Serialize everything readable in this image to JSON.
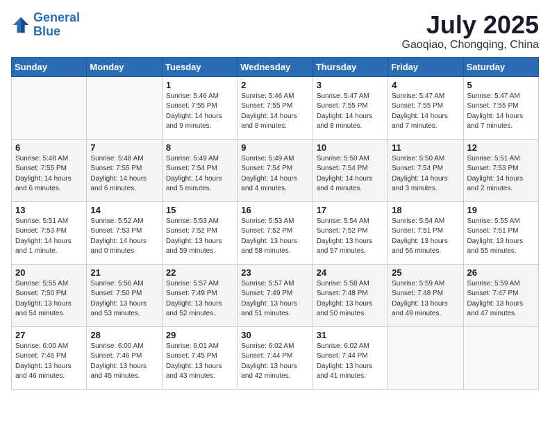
{
  "logo": {
    "line1": "General",
    "line2": "Blue"
  },
  "title": "July 2025",
  "location": "Gaoqiao, Chongqing, China",
  "days_of_week": [
    "Sunday",
    "Monday",
    "Tuesday",
    "Wednesday",
    "Thursday",
    "Friday",
    "Saturday"
  ],
  "weeks": [
    [
      {
        "day": "",
        "info": ""
      },
      {
        "day": "",
        "info": ""
      },
      {
        "day": "1",
        "info": "Sunrise: 5:46 AM\nSunset: 7:55 PM\nDaylight: 14 hours\nand 9 minutes."
      },
      {
        "day": "2",
        "info": "Sunrise: 5:46 AM\nSunset: 7:55 PM\nDaylight: 14 hours\nand 8 minutes."
      },
      {
        "day": "3",
        "info": "Sunrise: 5:47 AM\nSunset: 7:55 PM\nDaylight: 14 hours\nand 8 minutes."
      },
      {
        "day": "4",
        "info": "Sunrise: 5:47 AM\nSunset: 7:55 PM\nDaylight: 14 hours\nand 7 minutes."
      },
      {
        "day": "5",
        "info": "Sunrise: 5:47 AM\nSunset: 7:55 PM\nDaylight: 14 hours\nand 7 minutes."
      }
    ],
    [
      {
        "day": "6",
        "info": "Sunrise: 5:48 AM\nSunset: 7:55 PM\nDaylight: 14 hours\nand 6 minutes."
      },
      {
        "day": "7",
        "info": "Sunrise: 5:48 AM\nSunset: 7:55 PM\nDaylight: 14 hours\nand 6 minutes."
      },
      {
        "day": "8",
        "info": "Sunrise: 5:49 AM\nSunset: 7:54 PM\nDaylight: 14 hours\nand 5 minutes."
      },
      {
        "day": "9",
        "info": "Sunrise: 5:49 AM\nSunset: 7:54 PM\nDaylight: 14 hours\nand 4 minutes."
      },
      {
        "day": "10",
        "info": "Sunrise: 5:50 AM\nSunset: 7:54 PM\nDaylight: 14 hours\nand 4 minutes."
      },
      {
        "day": "11",
        "info": "Sunrise: 5:50 AM\nSunset: 7:54 PM\nDaylight: 14 hours\nand 3 minutes."
      },
      {
        "day": "12",
        "info": "Sunrise: 5:51 AM\nSunset: 7:53 PM\nDaylight: 14 hours\nand 2 minutes."
      }
    ],
    [
      {
        "day": "13",
        "info": "Sunrise: 5:51 AM\nSunset: 7:53 PM\nDaylight: 14 hours\nand 1 minute."
      },
      {
        "day": "14",
        "info": "Sunrise: 5:52 AM\nSunset: 7:53 PM\nDaylight: 14 hours\nand 0 minutes."
      },
      {
        "day": "15",
        "info": "Sunrise: 5:53 AM\nSunset: 7:52 PM\nDaylight: 13 hours\nand 59 minutes."
      },
      {
        "day": "16",
        "info": "Sunrise: 5:53 AM\nSunset: 7:52 PM\nDaylight: 13 hours\nand 58 minutes."
      },
      {
        "day": "17",
        "info": "Sunrise: 5:54 AM\nSunset: 7:52 PM\nDaylight: 13 hours\nand 57 minutes."
      },
      {
        "day": "18",
        "info": "Sunrise: 5:54 AM\nSunset: 7:51 PM\nDaylight: 13 hours\nand 56 minutes."
      },
      {
        "day": "19",
        "info": "Sunrise: 5:55 AM\nSunset: 7:51 PM\nDaylight: 13 hours\nand 55 minutes."
      }
    ],
    [
      {
        "day": "20",
        "info": "Sunrise: 5:55 AM\nSunset: 7:50 PM\nDaylight: 13 hours\nand 54 minutes."
      },
      {
        "day": "21",
        "info": "Sunrise: 5:56 AM\nSunset: 7:50 PM\nDaylight: 13 hours\nand 53 minutes."
      },
      {
        "day": "22",
        "info": "Sunrise: 5:57 AM\nSunset: 7:49 PM\nDaylight: 13 hours\nand 52 minutes."
      },
      {
        "day": "23",
        "info": "Sunrise: 5:57 AM\nSunset: 7:49 PM\nDaylight: 13 hours\nand 51 minutes."
      },
      {
        "day": "24",
        "info": "Sunrise: 5:58 AM\nSunset: 7:48 PM\nDaylight: 13 hours\nand 50 minutes."
      },
      {
        "day": "25",
        "info": "Sunrise: 5:59 AM\nSunset: 7:48 PM\nDaylight: 13 hours\nand 49 minutes."
      },
      {
        "day": "26",
        "info": "Sunrise: 5:59 AM\nSunset: 7:47 PM\nDaylight: 13 hours\nand 47 minutes."
      }
    ],
    [
      {
        "day": "27",
        "info": "Sunrise: 6:00 AM\nSunset: 7:46 PM\nDaylight: 13 hours\nand 46 minutes."
      },
      {
        "day": "28",
        "info": "Sunrise: 6:00 AM\nSunset: 7:46 PM\nDaylight: 13 hours\nand 45 minutes."
      },
      {
        "day": "29",
        "info": "Sunrise: 6:01 AM\nSunset: 7:45 PM\nDaylight: 13 hours\nand 43 minutes."
      },
      {
        "day": "30",
        "info": "Sunrise: 6:02 AM\nSunset: 7:44 PM\nDaylight: 13 hours\nand 42 minutes."
      },
      {
        "day": "31",
        "info": "Sunrise: 6:02 AM\nSunset: 7:44 PM\nDaylight: 13 hours\nand 41 minutes."
      },
      {
        "day": "",
        "info": ""
      },
      {
        "day": "",
        "info": ""
      }
    ]
  ]
}
